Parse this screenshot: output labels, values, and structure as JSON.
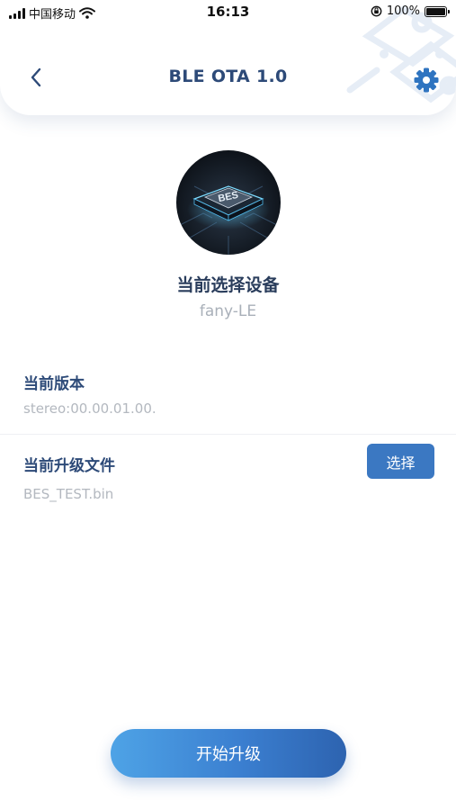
{
  "status_bar": {
    "carrier": "中国移动",
    "time": "16:13",
    "battery": "100%",
    "icons": [
      "signal-icon",
      "wifi-icon",
      "orientation-lock-icon",
      "battery-icon"
    ]
  },
  "header": {
    "title": "BLE OTA 1.0",
    "back_icon": "chevron-left-icon",
    "settings_icon": "gear-icon"
  },
  "device": {
    "chip_text": "BES",
    "label": "当前选择设备",
    "name": "fany-LE"
  },
  "version": {
    "title": "当前版本",
    "value": "stereo:00.00.01.00."
  },
  "upgrade_file": {
    "title": "当前升级文件",
    "value": "BES_TEST.bin",
    "select_label": "选择"
  },
  "actions": {
    "start_label": "开始升级"
  },
  "colors": {
    "accent": "#3b78c2",
    "title_blue": "#2d4a78",
    "muted_text": "#b3b8bf"
  }
}
